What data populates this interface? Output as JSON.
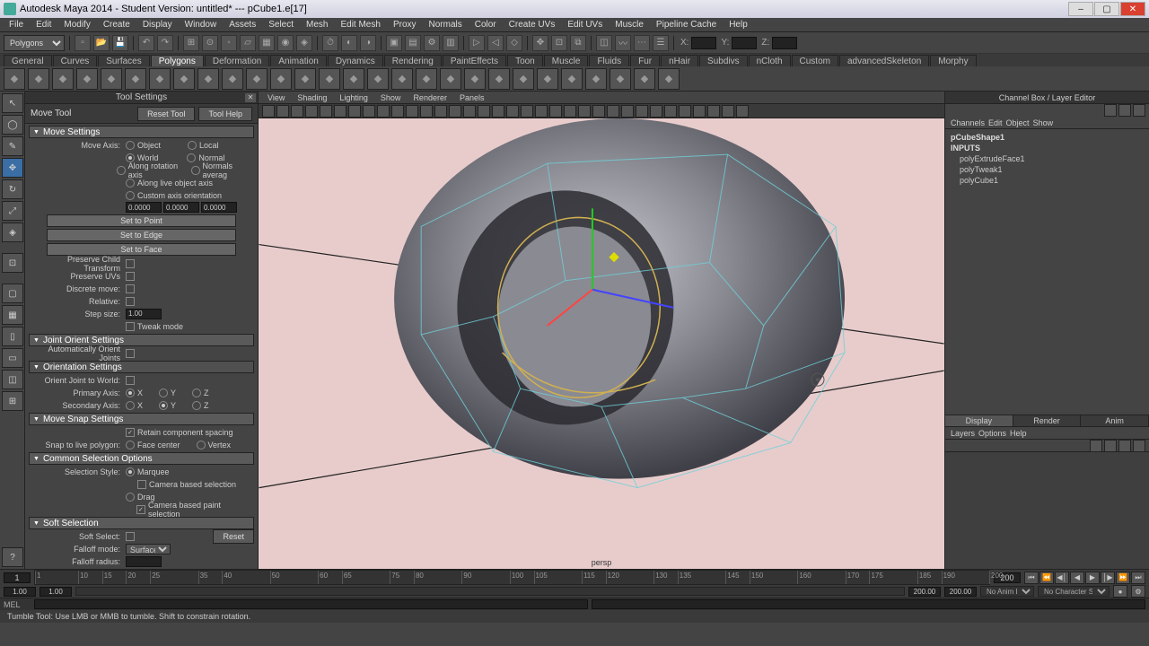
{
  "app": {
    "title": "Autodesk Maya 2014 - Student Version: untitled*  ---  pCube1.e[17]"
  },
  "menubar": [
    "File",
    "Edit",
    "Modify",
    "Create",
    "Display",
    "Window",
    "Assets",
    "Select",
    "Mesh",
    "Edit Mesh",
    "Proxy",
    "Normals",
    "Color",
    "Create UVs",
    "Edit UVs",
    "Muscle",
    "Pipeline Cache",
    "Help"
  ],
  "tb": {
    "mode": "Polygons",
    "xl": "X:",
    "yl": "Y:",
    "zl": "Z:"
  },
  "shelf_tabs": [
    "General",
    "Curves",
    "Surfaces",
    "Polygons",
    "Deformation",
    "Animation",
    "Dynamics",
    "Rendering",
    "PaintEffects",
    "Toon",
    "Muscle",
    "Fluids",
    "Fur",
    "nHair",
    "Subdivs",
    "nCloth",
    "Custom",
    "advancedSkeleton",
    "Morphy"
  ],
  "shelf_active": 3,
  "tool_settings": {
    "header": "Tool Settings",
    "tool": "Move Tool",
    "reset": "Reset Tool",
    "help": "Tool Help",
    "s_move": "Move Settings",
    "move_axis": "Move Axis:",
    "axes": [
      "Object",
      "Local",
      "World",
      "Normal",
      "Along rotation axis",
      "Normals averag",
      "Along live object axis",
      "Custom axis orientation"
    ],
    "nums": [
      "0.0000",
      "0.0000",
      "0.0000"
    ],
    "set": [
      "Set to Point",
      "Set to Edge",
      "Set to Face"
    ],
    "preserve_child": "Preserve Child Transform",
    "preserve_uv": "Preserve UVs",
    "discrete": "Discrete move:",
    "relative": "Relative:",
    "step": "Step size:",
    "step_v": "1.00",
    "tweak": "Tweak mode",
    "s_joint": "Joint Orient Settings",
    "auto_orient": "Automatically Orient Joints",
    "s_orient": "Orientation Settings",
    "orient_world": "Orient Joint to World:",
    "primary": "Primary Axis:",
    "secondary": "Secondary Axis:",
    "ax_x": "X",
    "ax_y": "Y",
    "ax_z": "Z",
    "s_snap": "Move Snap Settings",
    "retain": "Retain component spacing",
    "snap_live": "Snap to live polygon:",
    "face": "Face center",
    "vertex": "Vertex",
    "s_common": "Common Selection Options",
    "sel_style": "Selection Style:",
    "marquee": "Marquee",
    "cam1": "Camera based selection",
    "drag": "Drag",
    "cam2": "Camera based paint selection",
    "s_soft": "Soft Selection",
    "soft_sel": "Soft Select:",
    "reset_btn": "Reset",
    "falloff_mode": "Falloff mode:",
    "falloff_v": "Surface",
    "falloff_r": "Falloff radius:"
  },
  "vp_menus": [
    "View",
    "Shading",
    "Lighting",
    "Show",
    "Renderer",
    "Panels"
  ],
  "vp_label": "persp",
  "channel": {
    "header": "Channel Box / Layer Editor",
    "menus": [
      "Channels",
      "Edit",
      "Object",
      "Show"
    ],
    "shape": "pCubeShape1",
    "inputs": "INPUTS",
    "history": [
      "polyExtrudeFace1",
      "polyTweak1",
      "polyCube1"
    ],
    "layer_tabs": [
      "Display",
      "Render",
      "Anim"
    ],
    "layer_menus": [
      "Layers",
      "Options",
      "Help"
    ]
  },
  "timeline": {
    "start": "1",
    "end": "200",
    "ticks": [
      1,
      10,
      15,
      20,
      25,
      35,
      40,
      50,
      60,
      65,
      75,
      80,
      90,
      100,
      105,
      115,
      120,
      130,
      135,
      145,
      150,
      160,
      170,
      175,
      185,
      190,
      200
    ],
    "range_start": "1.00",
    "range_start2": "1.00",
    "range_end": "200.00",
    "range_end2": "200.00",
    "anim_layer": "No Anim Layer",
    "char_set": "No Character Set"
  },
  "cmd": "MEL",
  "help": "Tumble Tool: Use LMB or MMB to tumble. Shift to constrain rotation."
}
